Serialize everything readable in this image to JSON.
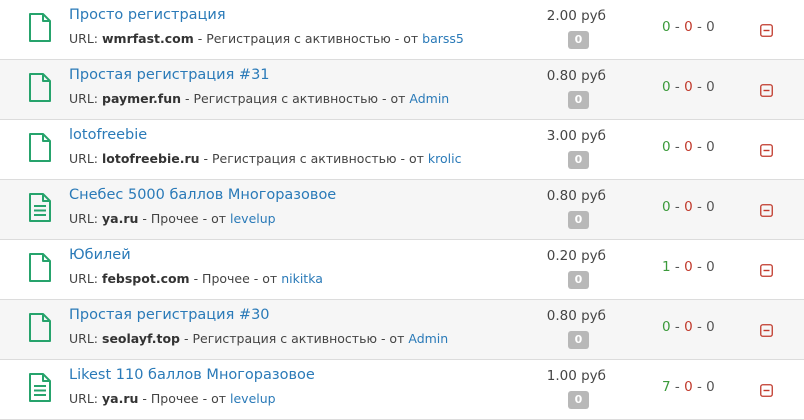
{
  "colors": {
    "accent_link": "#2a7ab8",
    "icon_green": "#26a36c",
    "ok_green": "#3b9a3b",
    "bad_red": "#c0392b",
    "remove_red": "#c0392b",
    "badge_gray": "#b8b8b8"
  },
  "labels": {
    "url_prefix": "URL:",
    "from": "- от",
    "sep": "-"
  },
  "tasks": [
    {
      "icon": "file-icon",
      "title": "Просто регистрация",
      "domain": "wmrfast.com",
      "category": "- Регистрация с активностью",
      "author": "barss5",
      "price": "2.00 руб",
      "badge": "0",
      "stat_a": "0",
      "stat_b": "0",
      "stat_c": "0"
    },
    {
      "icon": "file-icon",
      "title": "Простая регистрация #31",
      "domain": "paymer.fun",
      "category": "- Регистрация с активностью",
      "author": "Admin",
      "price": "0.80 руб",
      "badge": "0",
      "stat_a": "0",
      "stat_b": "0",
      "stat_c": "0"
    },
    {
      "icon": "file-icon",
      "title": "lotofreebie",
      "domain": "lotofreebie.ru",
      "category": "- Регистрация с активностью",
      "author": "krolic",
      "price": "3.00 руб",
      "badge": "0",
      "stat_a": "0",
      "stat_b": "0",
      "stat_c": "0"
    },
    {
      "icon": "file-text-icon",
      "title": "Снебес 5000 баллов Многоразовое",
      "domain": "ya.ru",
      "category": "- Прочее",
      "author": "levelup",
      "price": "0.80 руб",
      "badge": "0",
      "stat_a": "0",
      "stat_b": "0",
      "stat_c": "0"
    },
    {
      "icon": "file-icon",
      "title": "Юбилей",
      "domain": "febspot.com",
      "category": "- Прочее",
      "author": "nikitka",
      "price": "0.20 руб",
      "badge": "0",
      "stat_a": "1",
      "stat_b": "0",
      "stat_c": "0"
    },
    {
      "icon": "file-icon",
      "title": "Простая регистрация #30",
      "domain": "seolayf.top",
      "category": "- Регистрация с активностью",
      "author": "Admin",
      "price": "0.80 руб",
      "badge": "0",
      "stat_a": "0",
      "stat_b": "0",
      "stat_c": "0"
    },
    {
      "icon": "file-text-icon",
      "title": "Likest 110 баллов Многоразовое",
      "domain": "ya.ru",
      "category": "- Прочее",
      "author": "levelup",
      "price": "1.00 руб",
      "badge": "0",
      "stat_a": "7",
      "stat_b": "0",
      "stat_c": "0"
    }
  ]
}
